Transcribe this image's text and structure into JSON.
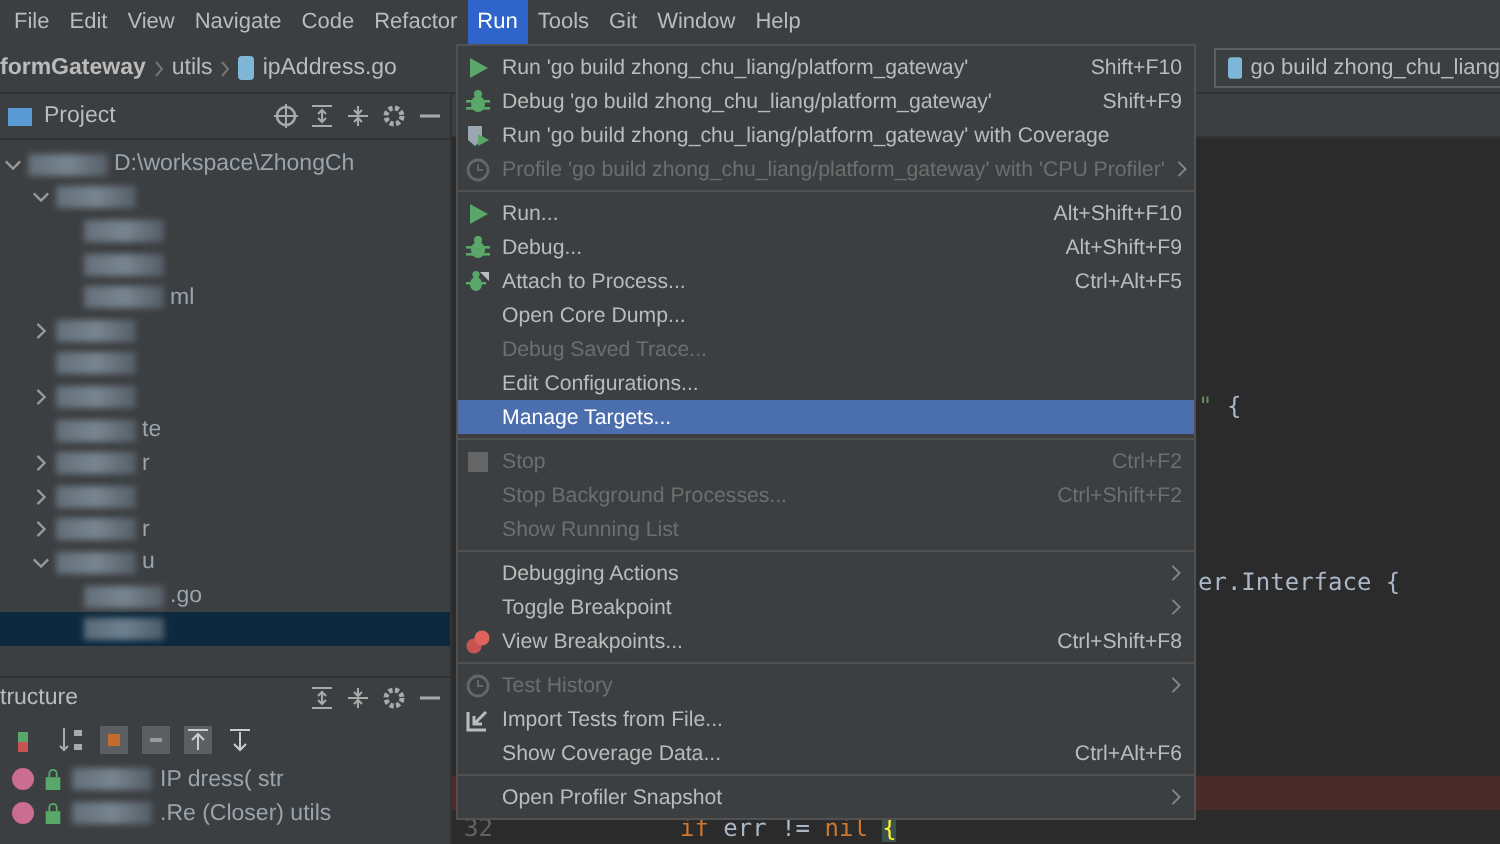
{
  "menu_bar": {
    "items": [
      {
        "label": "File",
        "selected": false
      },
      {
        "label": "Edit",
        "selected": false
      },
      {
        "label": "View",
        "selected": false
      },
      {
        "label": "Navigate",
        "selected": false
      },
      {
        "label": "Code",
        "selected": false
      },
      {
        "label": "Refactor",
        "selected": false
      },
      {
        "label": "Run",
        "selected": true
      },
      {
        "label": "Tools",
        "selected": false
      },
      {
        "label": "Git",
        "selected": false
      },
      {
        "label": "Window",
        "selected": false
      },
      {
        "label": "Help",
        "selected": false
      }
    ]
  },
  "breadcrumb": [
    "formGateway",
    "utils",
    "ipAddress.go"
  ],
  "run_config": {
    "label": "go build zhong_chu_liang"
  },
  "project_panel": {
    "title": "Project",
    "tree": [
      {
        "text": "D:\\workspace\\ZhongCh",
        "blurred": true,
        "expanded": true,
        "children": [
          {
            "blurred": true,
            "expanded": true,
            "children": [
              {
                "blurred": true
              },
              {
                "blurred": true
              },
              {
                "text": "ml",
                "blurred": true
              }
            ]
          },
          {
            "blurred": true,
            "expanded": false
          },
          {
            "blurred": true
          },
          {
            "blurred": true,
            "expanded": false
          },
          {
            "text": "te",
            "blurred": true
          },
          {
            "text": "r",
            "blurred": true,
            "expanded": false
          },
          {
            "blurred": true,
            "expanded": false
          },
          {
            "text": "r",
            "blurred": true,
            "expanded": false
          },
          {
            "text": "u",
            "blurred": true,
            "expanded": true,
            "children": [
              {
                "text": ".go",
                "blurred": true,
                "selected": false
              },
              {
                "blurred": true,
                "selected": true
              }
            ]
          }
        ]
      }
    ]
  },
  "structure_panel": {
    "title": "tructure",
    "rows": [
      {
        "text": "IP     dress(  str",
        "blurred": true
      },
      {
        "text": ".Re   (Closer)     utils",
        "blurred": true
      }
    ]
  },
  "run_menu": [
    {
      "kind": "play",
      "label": "Run 'go build zhong_chu_liang/platform_gateway'",
      "shortcut": "Shift+F10",
      "disabled": false
    },
    {
      "kind": "bug",
      "label": "Debug 'go build zhong_chu_liang/platform_gateway'",
      "shortcut": "Shift+F9",
      "disabled": false
    },
    {
      "kind": "coverage",
      "label": "Run 'go build zhong_chu_liang/platform_gateway' with Coverage",
      "disabled": false
    },
    {
      "kind": "profile",
      "label": "Profile 'go build zhong_chu_liang/platform_gateway' with 'CPU Profiler'",
      "disabled": true,
      "submenu": true
    },
    {
      "kind": "separator"
    },
    {
      "kind": "play",
      "label": "Run...",
      "shortcut": "Alt+Shift+F10",
      "disabled": false
    },
    {
      "kind": "bug",
      "label": "Debug...",
      "shortcut": "Alt+Shift+F9",
      "disabled": false
    },
    {
      "kind": "attach",
      "label": "Attach to Process...",
      "shortcut": "Ctrl+Alt+F5",
      "disabled": false
    },
    {
      "kind": "item",
      "label": "Open Core Dump...",
      "disabled": false
    },
    {
      "kind": "item",
      "label": "Debug Saved Trace...",
      "disabled": true
    },
    {
      "kind": "item",
      "label": "Edit Configurations...",
      "disabled": false
    },
    {
      "kind": "item",
      "label": "Manage Targets...",
      "disabled": false,
      "selected": true
    },
    {
      "kind": "separator"
    },
    {
      "kind": "stop",
      "label": "Stop",
      "shortcut": "Ctrl+F2",
      "disabled": true
    },
    {
      "kind": "item",
      "label": "Stop Background Processes...",
      "shortcut": "Ctrl+Shift+F2",
      "disabled": true
    },
    {
      "kind": "item",
      "label": "Show Running List",
      "disabled": true
    },
    {
      "kind": "separator"
    },
    {
      "kind": "item",
      "label": "Debugging Actions",
      "disabled": false,
      "submenu": true
    },
    {
      "kind": "item",
      "label": "Toggle Breakpoint",
      "disabled": false,
      "submenu": true
    },
    {
      "kind": "breakpoints",
      "label": "View Breakpoints...",
      "shortcut": "Ctrl+Shift+F8",
      "disabled": false
    },
    {
      "kind": "separator"
    },
    {
      "kind": "history",
      "label": "Test History",
      "disabled": true,
      "submenu": true
    },
    {
      "kind": "import",
      "label": "Import Tests from File...",
      "disabled": false
    },
    {
      "kind": "item",
      "label": "Show Coverage Data...",
      "shortcut": "Ctrl+Alt+F6",
      "disabled": false
    },
    {
      "kind": "separator"
    },
    {
      "kind": "item",
      "label": "Open Profiler Snapshot",
      "disabled": false,
      "submenu": true
    }
  ],
  "editor": {
    "lines": [
      {
        "kind": "blank"
      },
      {
        "kind": "blank"
      },
      {
        "kind": "blank"
      },
      {
        "kind": "blank"
      },
      {
        "kind": "blank"
      },
      {
        "kind": "blank"
      },
      {
        "kind": "blank"
      },
      {
        "kind": "continued",
        "tokens": [
          {
            "text": "\"",
            "kind": "string"
          },
          {
            "text": " {",
            "kind": "plain"
          }
        ]
      },
      {
        "kind": "blank"
      },
      {
        "kind": "blank"
      },
      {
        "kind": "blank"
      },
      {
        "kind": "blank"
      },
      {
        "kind": "continued",
        "tokens": [
          {
            "text": "er.Interface {",
            "kind": "plain"
          }
        ]
      },
      {
        "kind": "blank"
      },
      {
        "kind": "blank"
      },
      {
        "kind": "blank"
      },
      {
        "kind": "blank"
      },
      {
        "kind": "blank"
      },
      {
        "kind": "breakpoint"
      },
      {
        "kind": "code",
        "number": "32",
        "tokens": [
          {
            "text": "if",
            "kind": "keyword"
          },
          {
            "text": " err != ",
            "kind": "plain"
          },
          {
            "text": "nil",
            "kind": "keyword"
          },
          {
            "text": "{",
            "kind": "brace"
          }
        ]
      }
    ]
  }
}
